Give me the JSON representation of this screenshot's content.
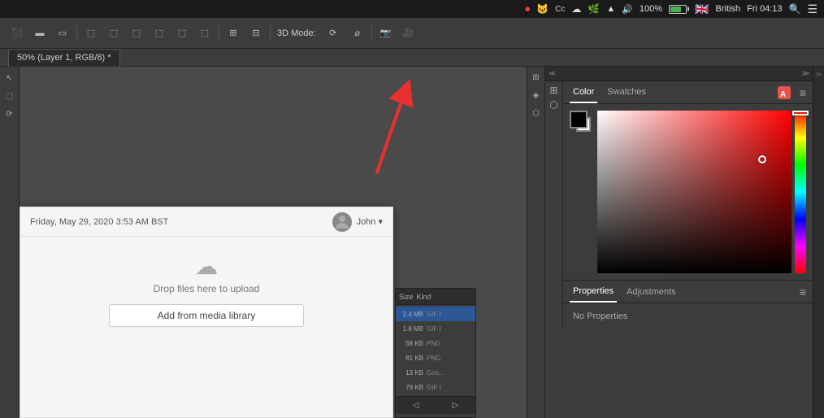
{
  "menubar": {
    "language": "British",
    "time": "Fri 04:13",
    "battery_pct": "100%",
    "wifi_icon": "wifi",
    "search_icon": "search",
    "menu_icon": "menu"
  },
  "toolbar": {
    "mode_label": "3D Mode:",
    "buttons": [
      "align-left",
      "align-center",
      "align-right",
      "distribute-top",
      "distribute-center",
      "distribute-bottom",
      "distribute-left",
      "distribute-center-h",
      "distribute-right",
      "group",
      "arrange",
      "align-extra",
      "transform",
      "warp",
      "3d-mode",
      "camera1",
      "camera2",
      "video"
    ]
  },
  "doc_tab": {
    "title": "50% (Layer 1, RGB/8) *"
  },
  "color_panel": {
    "color_tab": "Color",
    "swatches_tab": "Swatches",
    "menu_icon": "≡"
  },
  "properties_panel": {
    "properties_tab": "Properties",
    "adjustments_tab": "Adjustments",
    "menu_icon": "≡",
    "no_properties_text": "No Properties"
  },
  "wp_window": {
    "date": "Friday, May 29, 2020 3:53 AM BST",
    "username": "John ▾",
    "upload_icon": "☁",
    "upload_text": "cloud_upload",
    "drop_text": "Drop files here to upload",
    "media_btn": "Add from media library"
  },
  "files_panel": {
    "columns": [
      "Size",
      "Kind"
    ],
    "rows": [
      {
        "size": "2.4 MB",
        "kind": "GIF I"
      },
      {
        "size": "1.8 MB",
        "kind": "GIF I"
      },
      {
        "size": "58 KB",
        "kind": "PNG"
      },
      {
        "size": "81 KB",
        "kind": "PNG"
      },
      {
        "size": "13 KB",
        "kind": "Goo..."
      },
      {
        "size": "79 KB",
        "kind": "GIF I"
      }
    ]
  },
  "arrow_annotation": {
    "color": "#e83030",
    "description": "Red arrow pointing to toolbar area"
  }
}
